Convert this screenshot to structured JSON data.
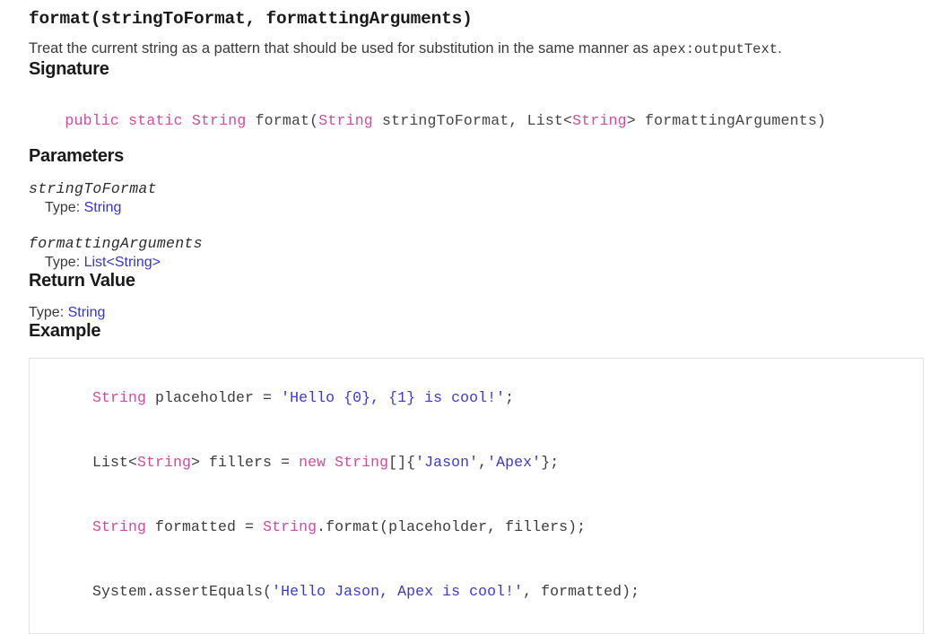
{
  "method": {
    "title": "format(stringToFormat, formattingArguments)",
    "description_parts": {
      "lead": "Treat the current string as a pattern that should be used for substitution in the same manner as ",
      "code": "apex:outputText",
      "trail": "."
    }
  },
  "sections": {
    "signature": {
      "heading": "Signature",
      "tokens": [
        {
          "text": "public static String ",
          "kind": "keyword"
        },
        {
          "text": "format(",
          "kind": "plain"
        },
        {
          "text": "String",
          "kind": "type"
        },
        {
          "text": " stringToFormat, List<",
          "kind": "plain"
        },
        {
          "text": "String",
          "kind": "type"
        },
        {
          "text": "> formattingArguments)",
          "kind": "plain"
        }
      ]
    },
    "parameters": {
      "heading": "Parameters",
      "type_label": "Type:",
      "items": [
        {
          "name": "stringToFormat",
          "type_parts": [
            {
              "text": "String",
              "kind": "link"
            }
          ]
        },
        {
          "name": "formattingArguments",
          "type_parts": [
            {
              "text": "List",
              "kind": "link"
            },
            {
              "text": "<",
              "kind": "angle"
            },
            {
              "text": "String",
              "kind": "link"
            },
            {
              "text": ">",
              "kind": "angle"
            }
          ]
        }
      ]
    },
    "return_value": {
      "heading": "Return Value",
      "type_label": "Type:",
      "type": "String"
    },
    "example": {
      "heading": "Example",
      "code_lines": [
        [
          {
            "text": "String",
            "kind": "type"
          },
          {
            "text": " placeholder = ",
            "kind": "plain"
          },
          {
            "text": "'Hello {0}, {1} is cool!'",
            "kind": "string"
          },
          {
            "text": ";",
            "kind": "plain"
          }
        ],
        [
          {
            "text": "List<",
            "kind": "plain"
          },
          {
            "text": "String",
            "kind": "type"
          },
          {
            "text": "> fillers = ",
            "kind": "plain"
          },
          {
            "text": "new",
            "kind": "keyword"
          },
          {
            "text": " ",
            "kind": "plain"
          },
          {
            "text": "String",
            "kind": "type"
          },
          {
            "text": "[]{",
            "kind": "plain"
          },
          {
            "text": "'Jason'",
            "kind": "string"
          },
          {
            "text": ",",
            "kind": "plain"
          },
          {
            "text": "'Apex'",
            "kind": "string"
          },
          {
            "text": "};",
            "kind": "plain"
          }
        ],
        [
          {
            "text": "String",
            "kind": "type"
          },
          {
            "text": " formatted = ",
            "kind": "plain"
          },
          {
            "text": "String",
            "kind": "type"
          },
          {
            "text": ".format(placeholder, fillers);",
            "kind": "plain"
          }
        ],
        [
          {
            "text": "System.assertEquals(",
            "kind": "plain"
          },
          {
            "text": "'Hello Jason, Apex is cool!'",
            "kind": "string"
          },
          {
            "text": ", formatted);",
            "kind": "plain"
          }
        ]
      ]
    }
  },
  "colors": {
    "keyword_pink": "#d24b9c",
    "link_blue": "#3535cc",
    "string_blue": "#3a3ad0",
    "body_text": "#3a3a3a",
    "heading_text": "#1a1a1a",
    "code_border": "#e2e2e2",
    "background": "#ffffff"
  }
}
